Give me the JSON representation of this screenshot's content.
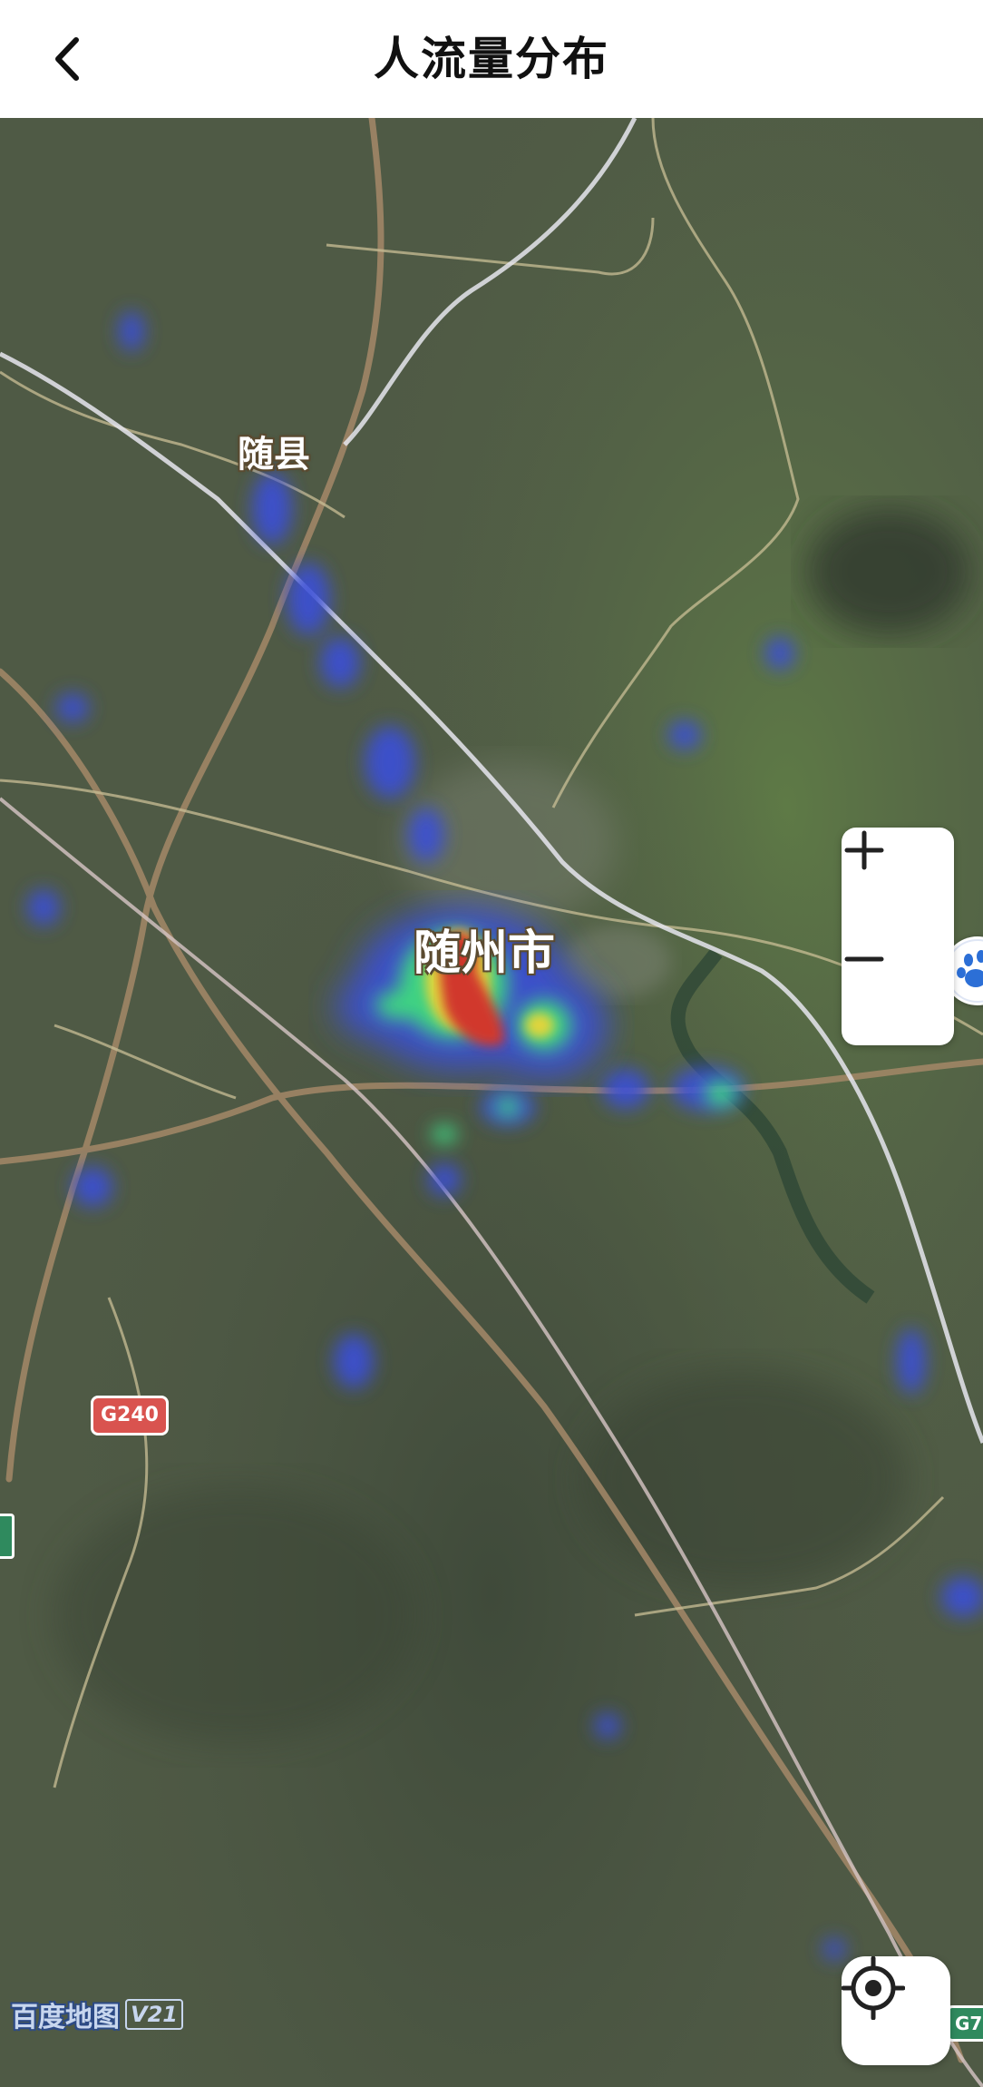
{
  "header": {
    "title": "人流量分布",
    "back_icon": "chevron-left-icon"
  },
  "map": {
    "city_labels": {
      "minor": "随县",
      "major": "随州市"
    },
    "road_shield": "G240",
    "road_shield_partial": "G7",
    "watermark": {
      "logo": "百度地图",
      "version": "V21"
    },
    "heatmap_colors": {
      "low": "#3a4fd8",
      "mid": "#3ce08a",
      "high": "#f2e23a",
      "peak": "#e0352a"
    }
  },
  "controls": {
    "zoom_in_icon": "plus-icon",
    "zoom_out_icon": "minus-icon",
    "locate_icon": "locate-crosshair-icon",
    "compass_icon": "baidu-paw-icon"
  }
}
